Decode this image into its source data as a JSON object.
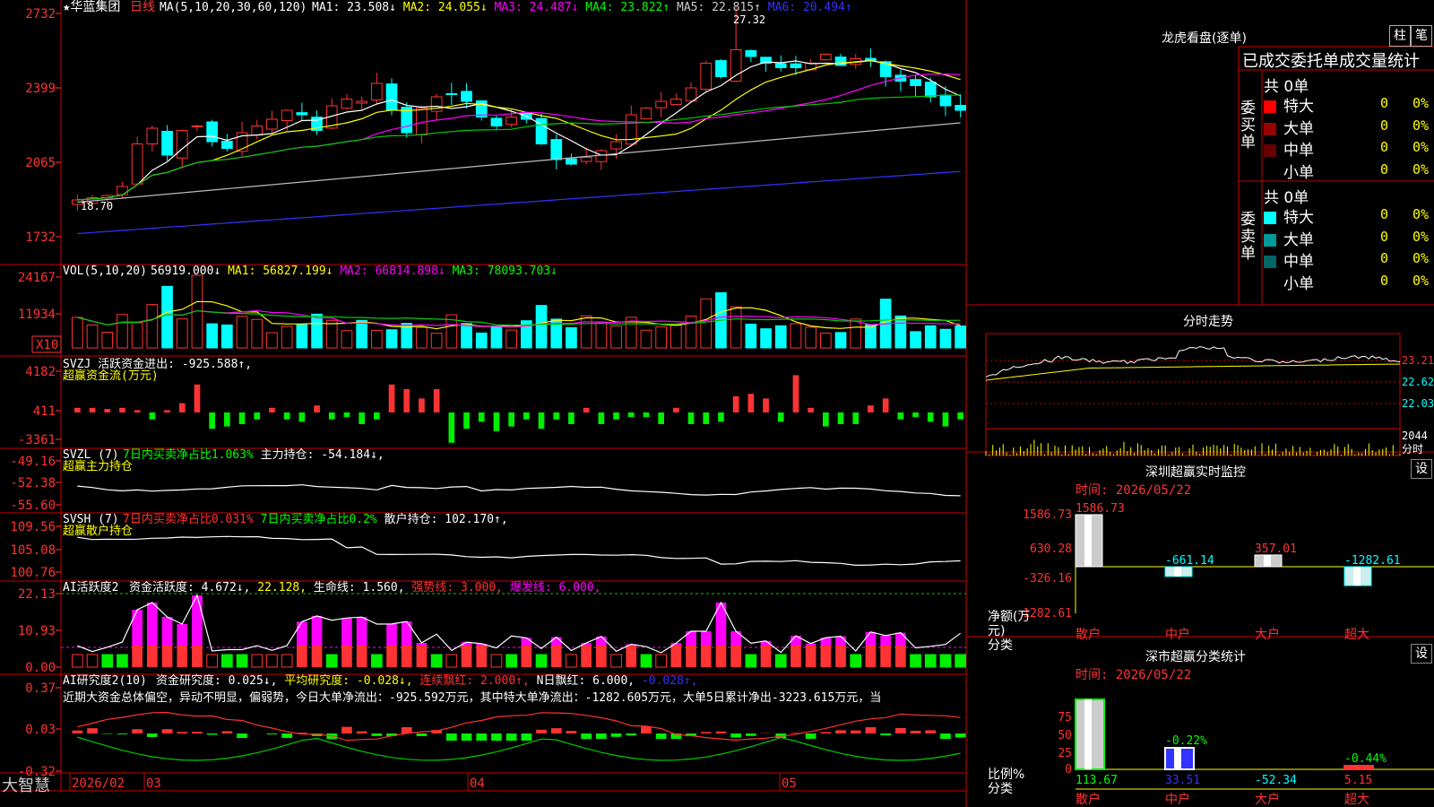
{
  "stock": {
    "name": "华蓝集团",
    "period": "日线",
    "ma_label": "MA(5,10,20,30,60,120)",
    "ma_values": [
      {
        "label": "MA1: 23.508↓",
        "color": "#ffffff"
      },
      {
        "label": "MA2: 24.055↓",
        "color": "#ffff00"
      },
      {
        "label": "MA3: 24.487↓",
        "color": "#ff00ff"
      },
      {
        "label": "MA4: 23.822↑",
        "color": "#00ff00"
      },
      {
        "label": "MA5: 22.815↑",
        "color": "#cccccc"
      },
      {
        "label": "MA6: 20.494↑",
        "color": "#3333ff"
      }
    ],
    "high_mark": "27.32",
    "low_mark": "18.70"
  },
  "axes": {
    "price_ticks": [
      "2732",
      "2399",
      "2065",
      "1732"
    ],
    "vol_ticks": [
      "24167",
      "11934"
    ],
    "vol_unit": "X10",
    "svzj_ticks": [
      "4182",
      "411",
      "-3361"
    ],
    "svzl_ticks": [
      "-49.16",
      "-52.38",
      "-55.60"
    ],
    "svsh_ticks": [
      "109.56",
      "105.08",
      "100.76"
    ],
    "ai_ticks": [
      "22.13",
      "10.93",
      "0.00"
    ],
    "res_ticks": [
      "0.37",
      "0.03",
      "-0.32"
    ],
    "dates": [
      "2026/02",
      "03",
      "04",
      "05"
    ]
  },
  "panels": {
    "vol_title": "VOL(5,10,20)",
    "vol_vals": [
      {
        "label": "56919.000↓",
        "color": "#ffffff"
      },
      {
        "label": "MA1: 56827.199↓",
        "color": "#ffff00"
      },
      {
        "label": "MA2: 66814.898↓",
        "color": "#ff00ff"
      },
      {
        "label": "MA3: 78093.703↓",
        "color": "#00ff00"
      }
    ],
    "svzj_title": "SVZJ  活跃资金进出: -925.588↑,",
    "svzj_sub": "超赢资金流(万元)",
    "svzl_title": "SVZL (7)",
    "svzl_vals": [
      {
        "label": "7日内买卖净占比1.063%",
        "color": "#00ff00"
      },
      {
        "label": "主力持仓: -54.184↓,",
        "color": "#ffffff"
      }
    ],
    "svzl_sub": "超赢主力持仓",
    "svsh_title": "SVSH (7)",
    "svsh_vals": [
      {
        "label": "7日内买卖净占比0.031%",
        "color": "#ff3333"
      },
      {
        "label": "7日内买卖净占比0.2%",
        "color": "#00ff00"
      },
      {
        "label": "散户持仓: 102.170↑,",
        "color": "#ffffff"
      }
    ],
    "svsh_sub": "超赢散户持仓",
    "ai_title": "AI活跃度2",
    "ai_vals": [
      {
        "label": "资金活跃度: 4.672↓,",
        "color": "#ffffff"
      },
      {
        "label": "22.128,",
        "color": "#ffff00"
      },
      {
        "label": "生命线: 1.560,",
        "color": "#ffffff"
      },
      {
        "label": "强势线: 3.000,",
        "color": "#ff3333"
      },
      {
        "label": "爆发线: 6.000,",
        "color": "#ff00ff"
      }
    ],
    "res_title": "AI研究度2(10)",
    "res_vals": [
      {
        "label": "资金研究度: 0.025↓,",
        "color": "#ffffff"
      },
      {
        "label": "平均研究度: -0.028↓,",
        "color": "#ffff00"
      },
      {
        "label": "连续飘红: 2.000↑,",
        "color": "#ff3333"
      },
      {
        "label": "N日飘红: 6.000,",
        "color": "#ffffff"
      },
      {
        "label": "-0.028↑,",
        "color": "#3333ff"
      }
    ],
    "res_text": "近期大资金总体偏空，异动不明显，偏弱势，今日大单净流出：-925.592万元，其中特大单净流出：-1282.605万元，大单5日累计净出-3223.615万元，当"
  },
  "right": {
    "lhb_title": "龙虎看盘(逐单)",
    "btn_bar": "柱",
    "btn_pen": "笔",
    "tabs": [
      "已成交",
      "委托单",
      "成交量统计"
    ],
    "buy_label": "委买单",
    "sell_label": "委卖单",
    "buy_total": "共 0单",
    "sell_total": "共 0单",
    "buy_rows": [
      {
        "name": "特大",
        "count": "0",
        "pct": "0%",
        "color": "#ff0000"
      },
      {
        "name": "大单",
        "count": "0",
        "pct": "0%",
        "color": "#990000"
      },
      {
        "name": "中单",
        "count": "0",
        "pct": "0%",
        "color": "#660000"
      },
      {
        "name": "小单",
        "count": "0",
        "pct": "0%",
        "color": "#000000"
      }
    ],
    "sell_rows": [
      {
        "name": "特大",
        "count": "0",
        "pct": "0%",
        "color": "#00ffff"
      },
      {
        "name": "大单",
        "count": "0",
        "pct": "0%",
        "color": "#009999"
      },
      {
        "name": "中单",
        "count": "0",
        "pct": "0%",
        "color": "#006666"
      },
      {
        "name": "小单",
        "count": "0",
        "pct": "0%",
        "color": "#000000"
      }
    ],
    "fs_title": "分时走势",
    "fs_ticks": [
      "23.21",
      "22.62",
      "22.03"
    ],
    "fs_vol": "2044",
    "fs_vol_unit": "分时",
    "monitor_title": "深圳超赢实时监控",
    "monitor_btn": "设",
    "monitor_time": "时间: 2026/05/22",
    "monitor_ticks": [
      "1586.73",
      "630.28",
      "-326.16",
      "-1282.61"
    ],
    "monitor_ylabel": "净额(万元)",
    "monitor_xlabel": "分类",
    "monitor_values": [
      "1586.73",
      "-661.14",
      "357.01",
      "-1282.61"
    ],
    "monitor_cats": [
      "散户",
      "中户",
      "大户",
      "超大"
    ],
    "class_title": "深市超赢分类统计",
    "class_btn": "设",
    "class_time": "时间: 2026/05/22",
    "class_ticks": [
      "75",
      "50",
      "25",
      "0"
    ],
    "class_ylabel": "比例%",
    "class_xlabel": "分类",
    "class_top": [
      "",
      "-0.22%",
      "",
      "-0.44%"
    ],
    "class_bottom": [
      "113.67",
      "33.51",
      "-52.34",
      "5.15"
    ],
    "class_cats": [
      "散户",
      "中户",
      "大户",
      "超大"
    ]
  },
  "footer": {
    "logo": "大智慧"
  },
  "colors": {
    "up": "#ff3333",
    "down": "#00ffff",
    "grid": "#aa0000"
  }
}
